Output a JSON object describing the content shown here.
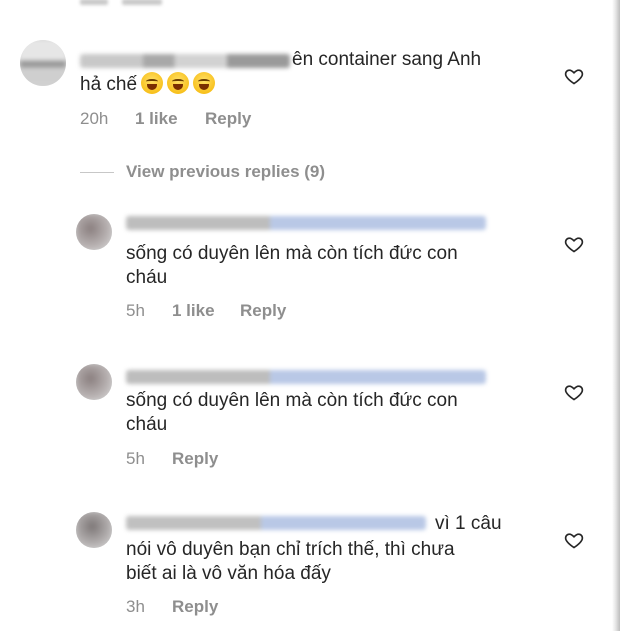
{
  "comments": [
    {
      "text_line1": "ên container sang Anh",
      "text_line2": "hả chế",
      "emoji_names": [
        "tears-of-joy-emoji",
        "tears-of-joy-emoji",
        "tears-of-joy-emoji"
      ],
      "time": "20h",
      "likes": "1 like",
      "reply": "Reply"
    },
    {
      "text_line1": "sống có duyên lên mà còn tích đức con",
      "text_line2": "cháu",
      "time": "5h",
      "likes": "1 like",
      "reply": "Reply"
    },
    {
      "text_line1": "sống có duyên lên mà còn tích đức con",
      "text_line2": "cháu",
      "time": "5h",
      "likes": "",
      "reply": "Reply"
    },
    {
      "text_line0": "vì 1 câu",
      "text_line1": "nói vô duyên bạn chỉ trích thế, thì chưa",
      "text_line2": "biết ai là vô văn hóa đấy",
      "time": "3h",
      "likes": "",
      "reply": "Reply"
    }
  ],
  "view_previous_replies": "View previous replies (9)",
  "icons": {
    "like": "heart-outline-icon"
  },
  "colors": {
    "text": "#262626",
    "meta": "#8e8e8e",
    "mention": "#b9c8e6"
  }
}
